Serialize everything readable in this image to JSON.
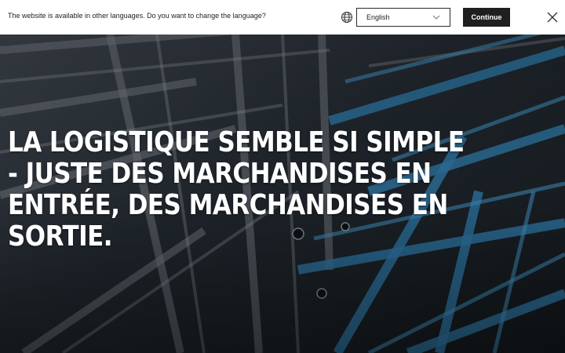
{
  "language_banner": {
    "message": "The website is available in other languages. Do you want to change the language?",
    "selected_language": "English",
    "continue_label": "Continue",
    "icons": {
      "globe": "globe-icon",
      "dropdown": "chevron-down-icon",
      "close": "close-icon"
    }
  },
  "hero": {
    "title_lines": [
      " LA LOGISTIQUE SEMBLE SI SIMPLE",
      "- JUSTE DES MARCHANDISES EN",
      "ENTRÉE, DES MARCHANDISES EN",
      "SORTIE."
    ]
  },
  "colors": {
    "banner_background": "#ffffff",
    "button_background": "#1f1f1f",
    "hero_text": "#ffffff",
    "hero_dark": "#1d2328",
    "hero_accent_blue": "#2b6f99"
  }
}
